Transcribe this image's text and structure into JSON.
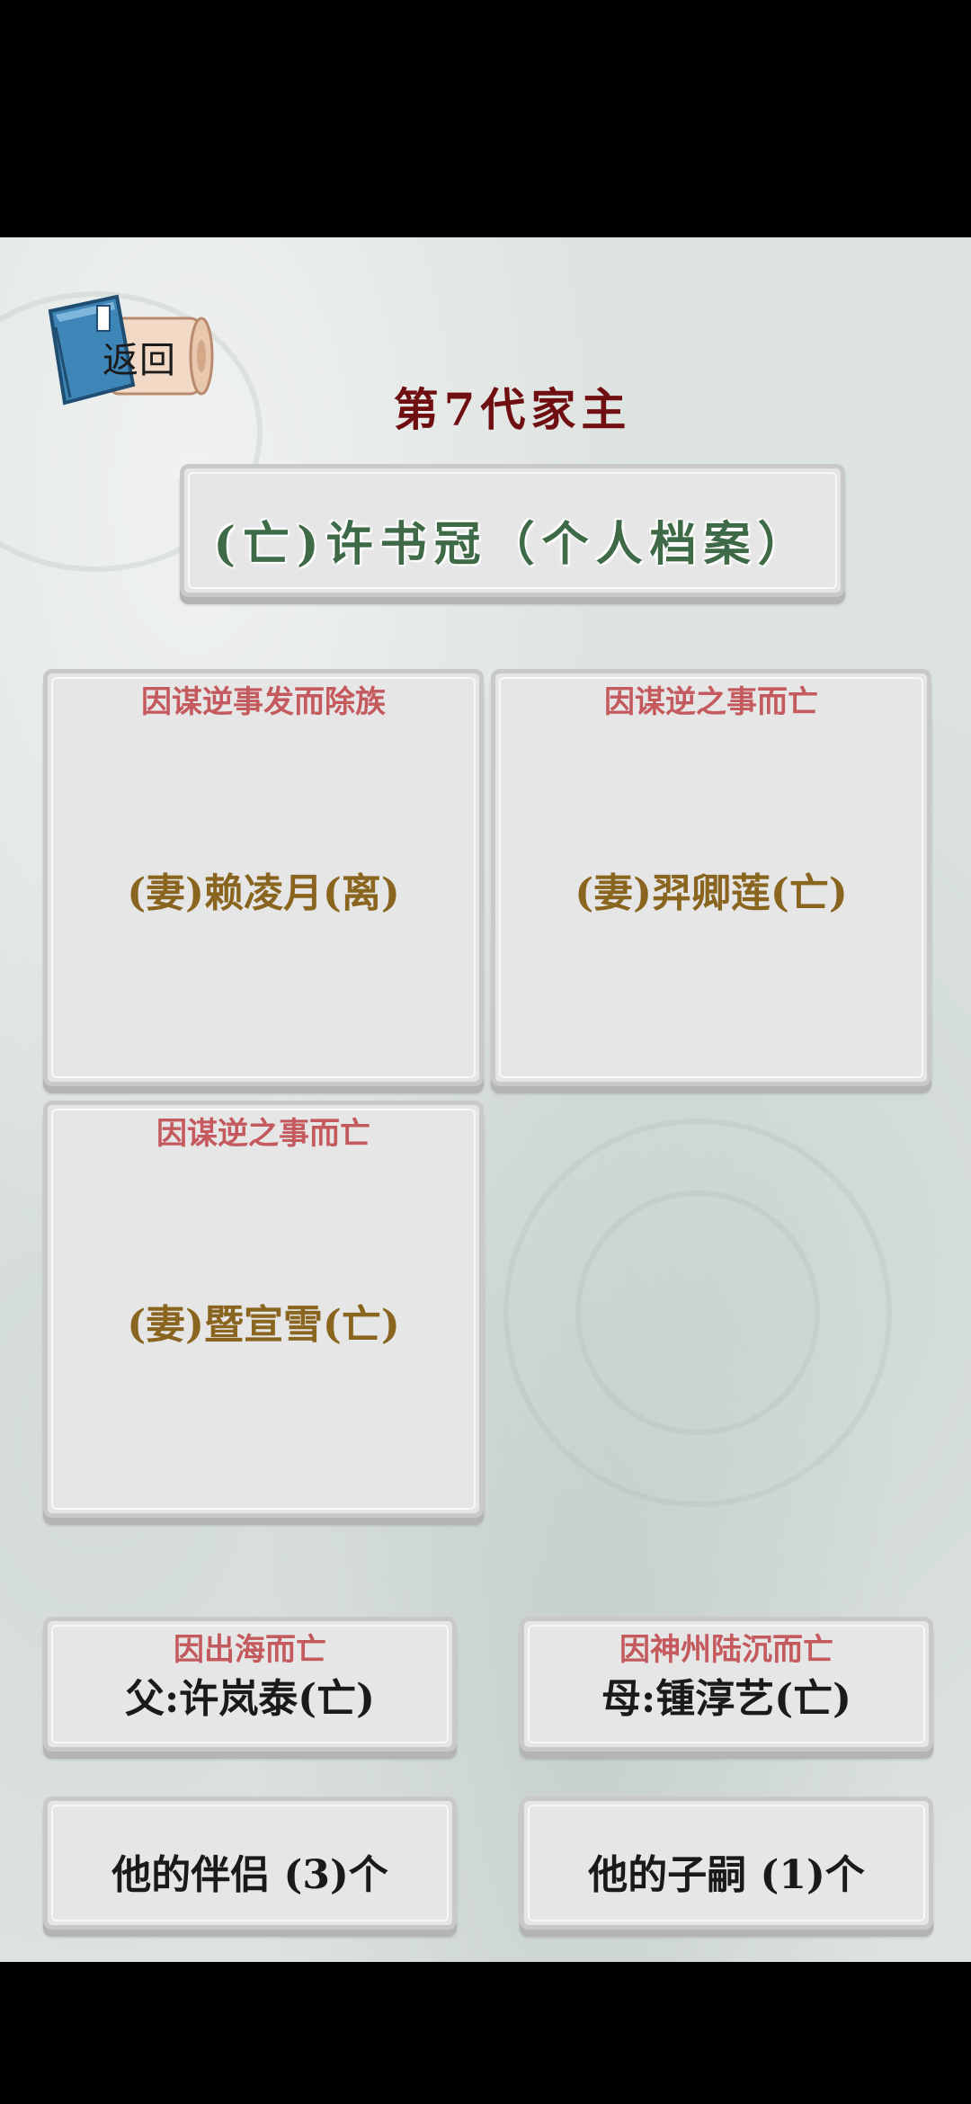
{
  "header": {
    "back_label": "返回",
    "generation_title": "第7代家主"
  },
  "profile": {
    "title": "(亡)许书冠（个人档案）"
  },
  "spouses": [
    {
      "cause": "因谋逆事发而除族",
      "name": "(妻)赖凌月(离)"
    },
    {
      "cause": "因谋逆之事而亡",
      "name": "(妻)羿卿莲(亡)"
    },
    {
      "cause": "因谋逆之事而亡",
      "name": "(妻)暨宣雪(亡)"
    }
  ],
  "parents": {
    "father": {
      "cause": "因出海而亡",
      "name": "父:许岚泰(亡)"
    },
    "mother": {
      "cause": "因神州陆沉而亡",
      "name": "母:锺淳艺(亡)"
    }
  },
  "buttons": {
    "partners": "他的伴侣 (3)个",
    "children": "他的子嗣 (1)个"
  },
  "colors": {
    "title": "#6f0f12",
    "profile_name": "#3f6a47",
    "cause": "#c45a5e",
    "spouse_name": "#8a6520",
    "paper": "#e6e6e6"
  }
}
